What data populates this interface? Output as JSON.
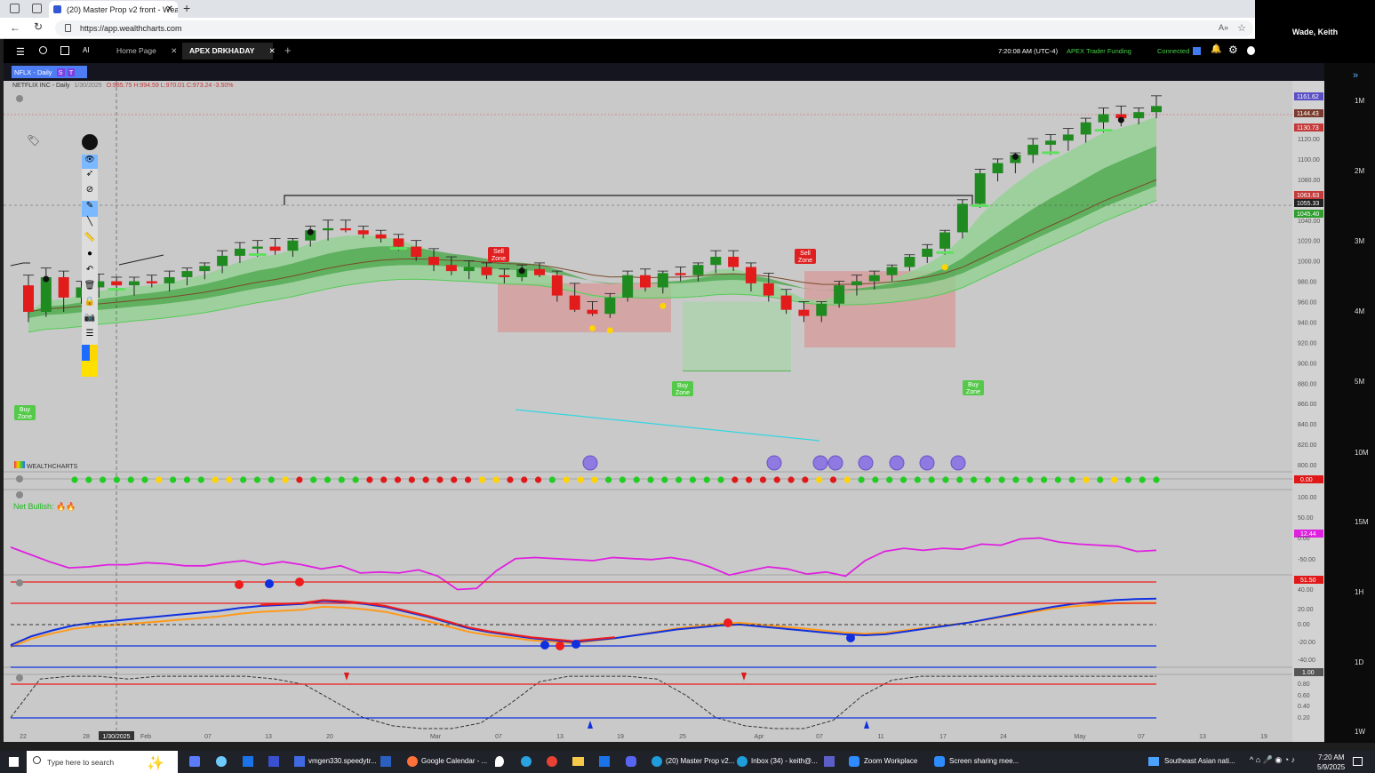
{
  "browser": {
    "tab_title": "(20) Master Prop v2 front - Wealt",
    "url": "https://app.wealthcharts.com",
    "user": "Wade, Keith"
  },
  "app": {
    "tabs": [
      {
        "label": "Home Page"
      },
      {
        "label": "APEX DRKHADAY"
      }
    ],
    "time": "7:20:08 AM (UTC-4)",
    "account": "APEX Trader Funding",
    "status": "Connected",
    "ai_label": "AI"
  },
  "symbol": {
    "tag": "NFLX - Daily",
    "badge_s": "S",
    "badge_t": "T",
    "title": "NETFLIX INC - Daily",
    "date": "1/30/2025",
    "ohlc": "O:985.75 H:994.59 L:970.01 C:973.24 -3.50%"
  },
  "timeframes": [
    "1M",
    "2M",
    "3M",
    "4M",
    "5M",
    "10M",
    "15M",
    "1H",
    "1D",
    "1W"
  ],
  "chart_data": {
    "type": "candlestick",
    "symbol": "NFLX",
    "interval": "Daily",
    "price_ticks": [
      1120,
      1100,
      1080,
      1040,
      1020,
      1000,
      980,
      960,
      940,
      920,
      900,
      880,
      860,
      840,
      820,
      800
    ],
    "price_labels": [
      {
        "v": "1161.62",
        "c": "#5a4fc4"
      },
      {
        "v": "1144.43",
        "c": "#7a3b2e"
      },
      {
        "v": "1130.73",
        "c": "#c43a3a"
      },
      {
        "v": "1063.63",
        "c": "#c43a3a"
      },
      {
        "v": "1055.33",
        "c": "#222222"
      },
      {
        "v": "1045.40",
        "c": "#2e9e2e"
      }
    ],
    "x_ticks": [
      "22",
      "28",
      "Feb",
      "07",
      "13",
      "20",
      "Mar",
      "07",
      "13",
      "19",
      "25",
      "Apr",
      "07",
      "11",
      "17",
      "24",
      "May",
      "07",
      "13",
      "19"
    ],
    "cursor_date": "1/30/2025",
    "zones": {
      "sell": "Sell Zone",
      "buy": "Buy Zone"
    },
    "candles": [
      [
        976,
        986,
        940,
        950
      ],
      [
        950,
        993,
        945,
        984
      ],
      [
        984,
        990,
        950,
        964
      ],
      [
        964,
        980,
        958,
        974
      ],
      [
        974,
        987,
        964,
        980
      ],
      [
        980,
        984,
        970,
        976
      ],
      [
        976,
        984,
        966,
        980
      ],
      [
        980,
        986,
        974,
        978
      ],
      [
        978,
        990,
        970,
        984
      ],
      [
        984,
        993,
        976,
        990
      ],
      [
        990,
        998,
        982,
        995
      ],
      [
        995,
        1010,
        988,
        1005
      ],
      [
        1005,
        1018,
        998,
        1012
      ],
      [
        1012,
        1020,
        1004,
        1014
      ],
      [
        1014,
        1022,
        1006,
        1010
      ],
      [
        1010,
        1022,
        1004,
        1020
      ],
      [
        1020,
        1034,
        1014,
        1030
      ],
      [
        1030,
        1040,
        1020,
        1032
      ],
      [
        1032,
        1040,
        1028,
        1030
      ],
      [
        1030,
        1034,
        1022,
        1026
      ],
      [
        1026,
        1030,
        1018,
        1022
      ],
      [
        1022,
        1026,
        1010,
        1014
      ],
      [
        1014,
        1020,
        1000,
        1004
      ],
      [
        1004,
        1012,
        990,
        996
      ],
      [
        996,
        1004,
        986,
        990
      ],
      [
        990,
        1000,
        982,
        994
      ],
      [
        994,
        998,
        982,
        986
      ],
      [
        986,
        992,
        978,
        984
      ],
      [
        984,
        996,
        980,
        992
      ],
      [
        992,
        998,
        984,
        986
      ],
      [
        986,
        990,
        960,
        966
      ],
      [
        966,
        978,
        950,
        952
      ],
      [
        952,
        960,
        946,
        948
      ],
      [
        948,
        968,
        944,
        964
      ],
      [
        964,
        990,
        960,
        986
      ],
      [
        986,
        992,
        970,
        974
      ],
      [
        974,
        990,
        968,
        988
      ],
      [
        988,
        994,
        980,
        986
      ],
      [
        986,
        998,
        980,
        996
      ],
      [
        996,
        1010,
        988,
        1004
      ],
      [
        1004,
        1010,
        990,
        994
      ],
      [
        994,
        998,
        970,
        978
      ],
      [
        978,
        988,
        960,
        966
      ],
      [
        966,
        972,
        948,
        952
      ],
      [
        952,
        960,
        940,
        946
      ],
      [
        946,
        960,
        940,
        958
      ],
      [
        958,
        980,
        954,
        976
      ],
      [
        976,
        986,
        966,
        980
      ],
      [
        980,
        990,
        972,
        986
      ],
      [
        986,
        996,
        980,
        994
      ],
      [
        994,
        1006,
        990,
        1004
      ],
      [
        1004,
        1016,
        998,
        1012
      ],
      [
        1012,
        1030,
        1006,
        1028
      ],
      [
        1028,
        1060,
        1022,
        1056
      ],
      [
        1056,
        1090,
        1052,
        1086
      ],
      [
        1086,
        1100,
        1078,
        1096
      ],
      [
        1096,
        1106,
        1086,
        1104
      ],
      [
        1104,
        1120,
        1096,
        1114
      ],
      [
        1114,
        1124,
        1104,
        1118
      ],
      [
        1118,
        1130,
        1108,
        1124
      ],
      [
        1124,
        1140,
        1116,
        1136
      ],
      [
        1136,
        1150,
        1126,
        1144
      ],
      [
        1144,
        1152,
        1132,
        1140
      ],
      [
        1140,
        1150,
        1134,
        1146
      ],
      [
        1146,
        1162,
        1140,
        1152
      ]
    ],
    "indicators": {
      "brand": "WEALTHCHARTS",
      "net_label": "Net Bullish:",
      "osc1_value": "12.44",
      "osc2_value": "51.50",
      "osc3_value": "1.00",
      "osc0_value": "0.00",
      "osc1_ticks": [
        "100.00",
        "50.00",
        "0.00",
        "-50.00"
      ],
      "osc2_ticks": [
        "40.00",
        "20.00",
        "0.00",
        "-20.00",
        "-40.00"
      ],
      "osc3_ticks": [
        "0.80",
        "0.60",
        "0.40",
        "0.20"
      ]
    }
  },
  "taskbar": {
    "search": "Type here to search",
    "apps": [
      "vmgen330.speedytr...",
      "Google Calendar - ...",
      "(20) Master Prop v2...",
      "Inbox (34) - keith@...",
      "Zoom Workplace",
      "Screen sharing mee..."
    ],
    "news": "Southeast Asian nati...",
    "time": "7:20 AM",
    "date": "5/9/2025"
  }
}
